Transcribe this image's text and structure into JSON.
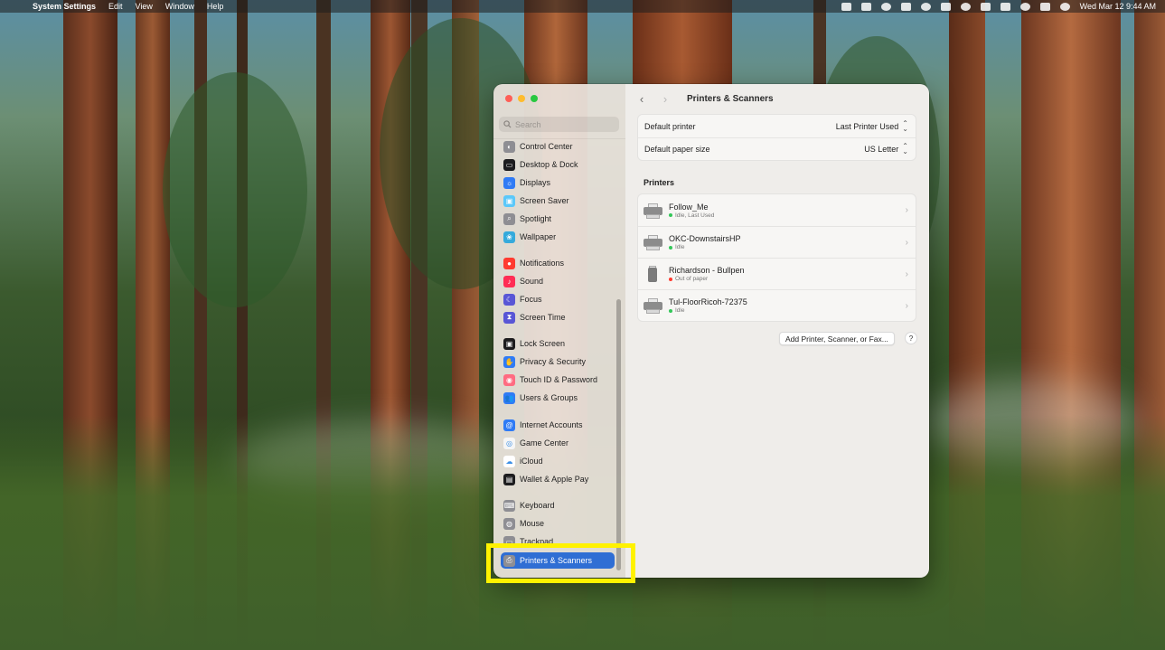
{
  "menubar": {
    "app_name": "System Settings",
    "menus": [
      "Edit",
      "View",
      "Window",
      "Help"
    ],
    "clock": "Wed Mar 12  9:44 AM"
  },
  "search": {
    "placeholder": "Search"
  },
  "sidebar": {
    "items": [
      {
        "label": "Control Center",
        "icon": "control-center-icon",
        "color": "#8e8e93"
      },
      {
        "label": "Desktop & Dock",
        "icon": "desktop-dock-icon",
        "color": "#1c1c1e"
      },
      {
        "label": "Displays",
        "icon": "displays-icon",
        "color": "#2f7bf5"
      },
      {
        "label": "Screen Saver",
        "icon": "screen-saver-icon",
        "color": "#5ac8fa"
      },
      {
        "label": "Spotlight",
        "icon": "spotlight-icon",
        "color": "#8e8e93"
      },
      {
        "label": "Wallpaper",
        "icon": "wallpaper-icon",
        "color": "#34aadc"
      },
      {
        "label": "Notifications",
        "icon": "notifications-icon",
        "color": "#ff3b30"
      },
      {
        "label": "Sound",
        "icon": "sound-icon",
        "color": "#ff2d55"
      },
      {
        "label": "Focus",
        "icon": "focus-icon",
        "color": "#5856d6"
      },
      {
        "label": "Screen Time",
        "icon": "screen-time-icon",
        "color": "#5856d6"
      },
      {
        "label": "Lock Screen",
        "icon": "lock-screen-icon",
        "color": "#1c1c1e"
      },
      {
        "label": "Privacy & Security",
        "icon": "privacy-security-icon",
        "color": "#2f7bf5"
      },
      {
        "label": "Touch ID & Password",
        "icon": "touch-id-icon",
        "color": "#ff6b81"
      },
      {
        "label": "Users & Groups",
        "icon": "users-groups-icon",
        "color": "#2f7bf5"
      },
      {
        "label": "Internet Accounts",
        "icon": "internet-accounts-icon",
        "color": "#2f7bf5"
      },
      {
        "label": "Game Center",
        "icon": "game-center-icon",
        "color": "#f5f5f5"
      },
      {
        "label": "iCloud",
        "icon": "icloud-icon",
        "color": "#ffffff"
      },
      {
        "label": "Wallet & Apple Pay",
        "icon": "wallet-icon",
        "color": "#1c1c1e"
      },
      {
        "label": "Keyboard",
        "icon": "keyboard-icon",
        "color": "#8e8e93"
      },
      {
        "label": "Mouse",
        "icon": "mouse-icon",
        "color": "#8e8e93"
      },
      {
        "label": "Trackpad",
        "icon": "trackpad-icon",
        "color": "#8e8e93"
      },
      {
        "label": "Printers & Scanners",
        "icon": "printer-icon",
        "color": "#8e8e93"
      }
    ]
  },
  "content": {
    "title": "Printers & Scanners",
    "default_printer_label": "Default printer",
    "default_printer_value": "Last Printer Used",
    "paper_size_label": "Default paper size",
    "paper_size_value": "US Letter",
    "printers_title": "Printers",
    "printers": [
      {
        "name": "Follow_Me",
        "status": "Idle, Last Used",
        "status_color": "#34c759"
      },
      {
        "name": "OKC-DownstairsHP",
        "status": "Idle",
        "status_color": "#34c759"
      },
      {
        "name": "Richardson - Bullpen",
        "status": "Out of paper",
        "status_color": "#ff3b30"
      },
      {
        "name": "Tul-FloorRicoh-72375",
        "status": "Idle",
        "status_color": "#34c759"
      }
    ],
    "add_button": "Add Printer, Scanner, or Fax...",
    "help_button": "?"
  }
}
